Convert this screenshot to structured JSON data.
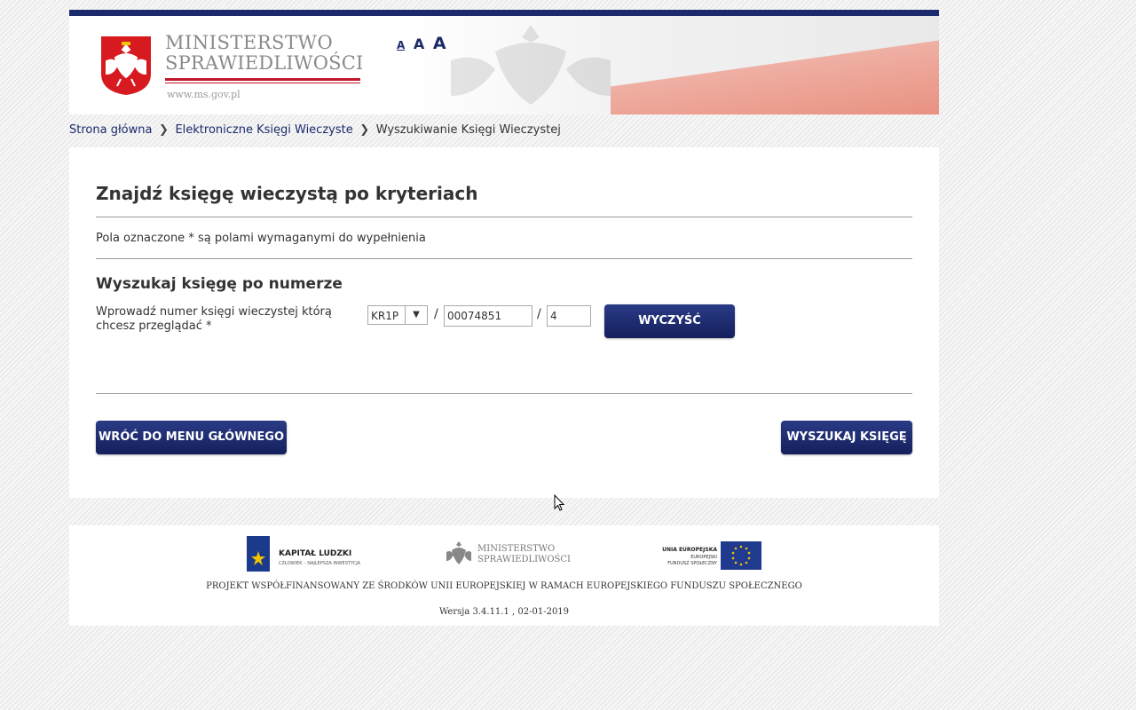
{
  "header": {
    "ministry_line1": "MINISTERSTWO",
    "ministry_line2": "SPRAWIEDLIWOŚCI",
    "url": "www.ms.gov.pl",
    "font_sizes": [
      "A",
      "A",
      "A"
    ],
    "colors": {
      "navy": "#1b2a6b",
      "red": "#c0182a"
    }
  },
  "breadcrumb": {
    "items": [
      "Strona główna",
      "Elektroniczne Księgi Wieczyste"
    ],
    "current": "Wyszukiwanie Księgi Wieczystej"
  },
  "main": {
    "title": "Znajdź księgę wieczystą po kryteriach",
    "required_note": "Pola oznaczone * są polami wymaganymi do wypełnienia",
    "section_title": "Wyszukaj księgę po numerze",
    "field_label": "Wprowadź numer księgi wieczystej którą chcesz przeglądać *",
    "court_code": "KR1P",
    "book_number": "00074851",
    "check_digit": "4",
    "separator": "/",
    "clear_button": "WYCZYŚĆ",
    "back_button": "WRÓĆ DO MENU GŁÓWNEGO",
    "search_button": "WYSZUKAJ KSIĘGĘ"
  },
  "footer": {
    "kl_title": "KAPITAŁ LUDZKI",
    "kl_subtitle": "CZŁOWIEK – NAJLEPSZA INWESTYCJA",
    "ms_line1": "MINISTERSTWO",
    "ms_line2": "SPRAWIEDLIWOŚCI",
    "ue_line1": "UNIA EUROPEJSKA",
    "ue_line2": "EUROPEJSKI",
    "ue_line3": "FUNDUSZ SPOŁECZNY",
    "project": "PROJEKT WSPÓŁFINANSOWANY ZE ŚRODKÓW UNII EUROPEJSKIEJ W RAMACH EUROPEJSKIEGO FUNDUSZU SPOŁECZNEGO",
    "version": "Wersja 3.4.11.1 , 02-01-2019"
  }
}
